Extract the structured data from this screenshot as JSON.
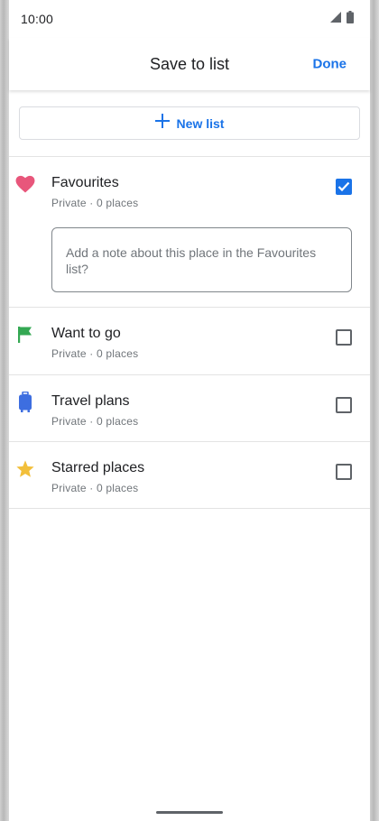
{
  "status_bar": {
    "time": "10:00"
  },
  "header": {
    "title": "Save to list",
    "done_label": "Done"
  },
  "new_list": {
    "label": "New list"
  },
  "lists": [
    {
      "name": "Favourites",
      "meta": "Private · 0 places",
      "icon": "heart-icon",
      "icon_color": "#e8567b",
      "checked": true
    },
    {
      "name": "Want to go",
      "meta": "Private · 0 places",
      "icon": "flag-icon",
      "icon_color": "#34a853",
      "checked": false
    },
    {
      "name": "Travel plans",
      "meta": "Private · 0 places",
      "icon": "suitcase-icon",
      "icon_color": "#3d6ee0",
      "checked": false
    },
    {
      "name": "Starred places",
      "meta": "Private · 0 places",
      "icon": "star-icon",
      "icon_color": "#f2bf3b",
      "checked": false
    }
  ],
  "note": {
    "placeholder": "Add a note about this place in the Favourites list?"
  },
  "colors": {
    "accent": "#1a73e8",
    "divider": "#e3e3e3"
  }
}
